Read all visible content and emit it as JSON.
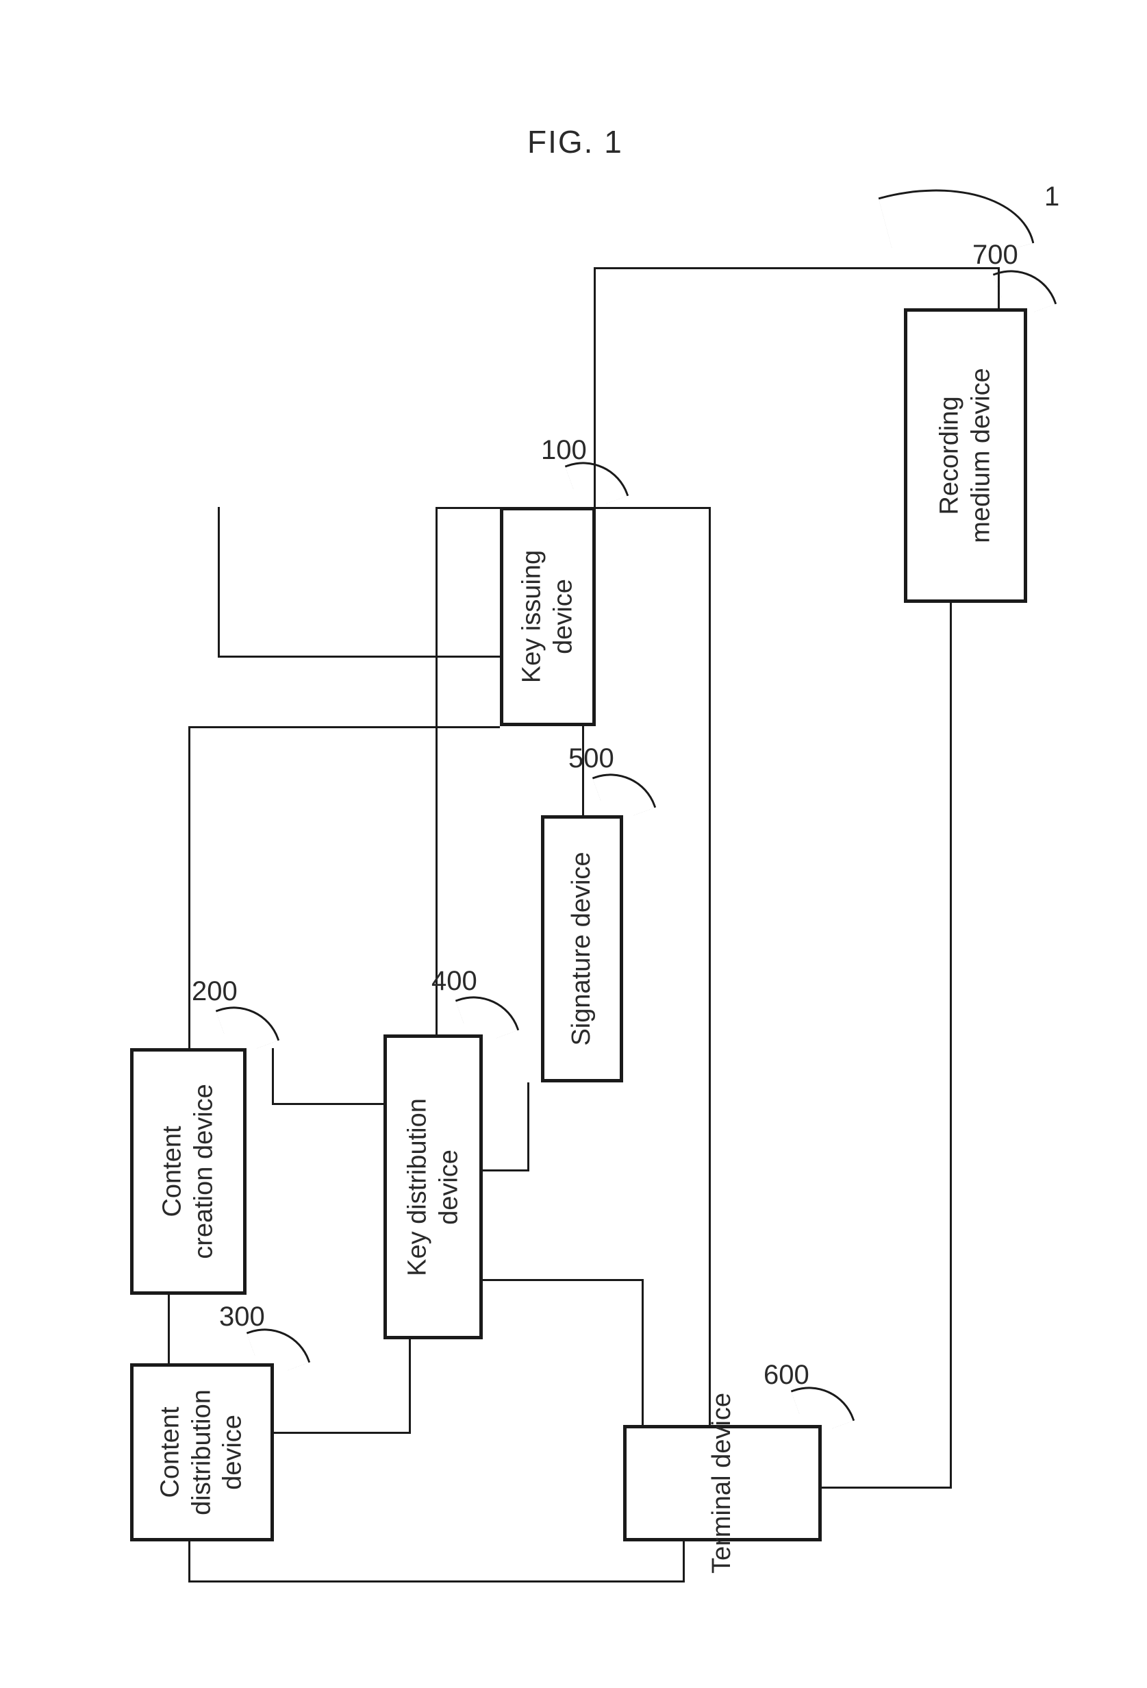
{
  "figure": {
    "title": "FIG. 1",
    "system_ref": "1"
  },
  "boxes": {
    "key_issuing": {
      "ref": "100",
      "label": "Key issuing\ndevice"
    },
    "content_creation": {
      "ref": "200",
      "label": "Content\ncreation device"
    },
    "content_dist": {
      "ref": "300",
      "label": "Content\ndistribution\ndevice"
    },
    "key_dist": {
      "ref": "400",
      "label": "Key distribution\ndevice"
    },
    "signature": {
      "ref": "500",
      "label": "Signature device"
    },
    "terminal": {
      "ref": "600",
      "label": "Terminal device"
    },
    "recording": {
      "ref": "700",
      "label": "Recording\nmedium device"
    }
  }
}
